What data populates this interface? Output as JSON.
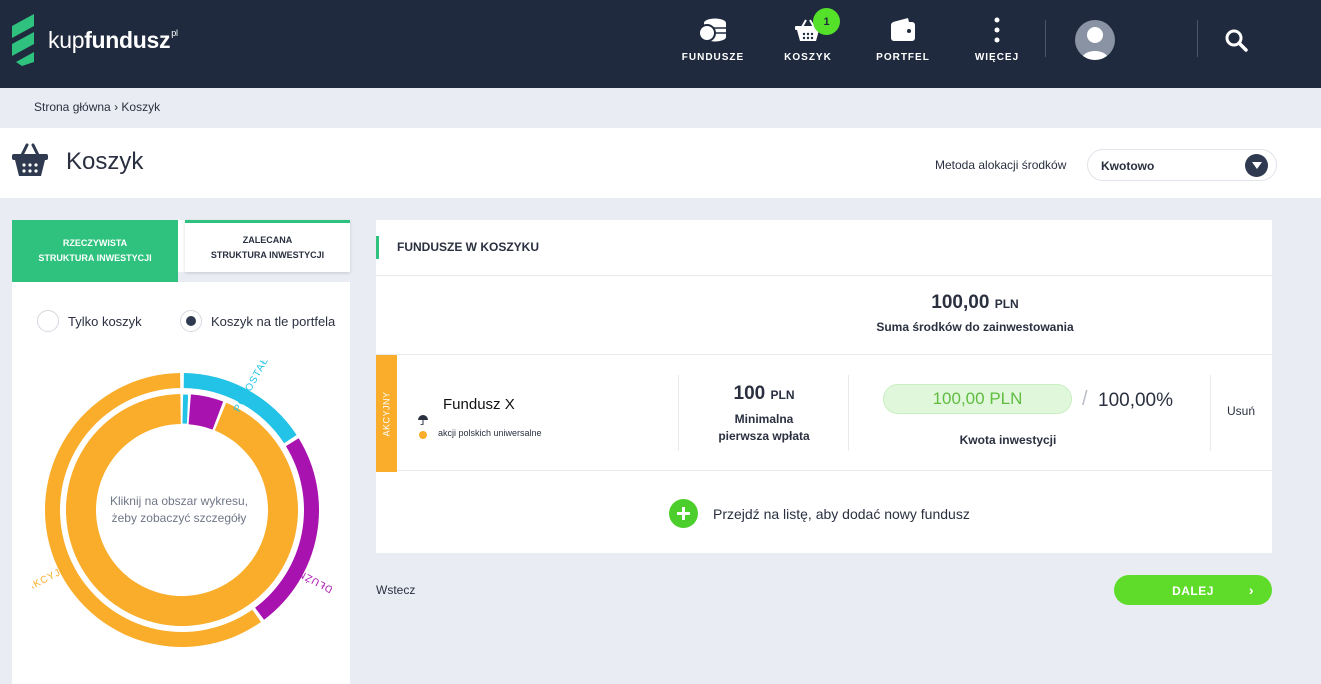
{
  "brand": {
    "name_light": "kup",
    "name_bold": "fundusz",
    "superscript": "pl"
  },
  "nav": {
    "items": [
      {
        "label": "FUNDUSZE"
      },
      {
        "label": "KOSZYK",
        "badge": "1"
      },
      {
        "label": "PORTFEL"
      },
      {
        "label": "WIĘCEJ"
      }
    ]
  },
  "breadcrumb": {
    "home": "Strona główna",
    "separator": "›",
    "current": "Koszyk"
  },
  "header": {
    "title": "Koszyk",
    "allocation_label": "Metoda alokacji środków",
    "allocation_value": "Kwotowo"
  },
  "left_panel": {
    "tabs": [
      {
        "line1": "RZECZYWISTA",
        "line2": "STRUKTURA INWESTYCJI",
        "active": true
      },
      {
        "line1": "ZALECANA",
        "line2": "STRUKTURA INWESTYCJI",
        "active": false
      }
    ],
    "radio_options": [
      {
        "label": "Tylko koszyk",
        "selected": false
      },
      {
        "label": "Koszyk na tle portfela",
        "selected": true
      }
    ],
    "chart_hint_line1": "Kliknij na obszar wykresu,",
    "chart_hint_line2": "żeby zobaczyć szczegóły"
  },
  "chart_data": {
    "type": "donut",
    "categories": [
      "POZOSTAŁE",
      "DŁUŻNE",
      "AKCYJNE"
    ],
    "colors": {
      "POZOSTAŁE": "#22c3e6",
      "DŁUŻNE": "#a812ae",
      "AKCYJNE": "#f9ad2a"
    },
    "series": [
      {
        "values": [
          16,
          24,
          60
        ]
      },
      {
        "values": [
          1,
          5,
          94
        ]
      }
    ]
  },
  "cart": {
    "title": "FUNDUSZE W KOSZYKU",
    "sum_value": "100,00",
    "sum_currency": "PLN",
    "sum_label": "Suma środków do zainwestowania",
    "fund": {
      "tag": "AKCYJNY",
      "name": "Fundusz X",
      "category": "akcji polskich uniwersalne",
      "min_value": "100",
      "min_currency": "PLN",
      "min_label_line1": "Minimalna",
      "min_label_line2": "pierwsza wpłata",
      "amount": "100,00 PLN",
      "slash": "/",
      "percent": "100,00%",
      "amount_label": "Kwota inwestycji",
      "remove": "Usuń"
    },
    "add_fund_text": "Przejdź na listę, aby dodać nowy fundusz"
  },
  "footer": {
    "back": "Wstecz",
    "next": "DALEJ",
    "next_chevron": "›"
  },
  "colors": {
    "topbar": "#1f2a3e",
    "accent_green": "#2fc27e",
    "button_green": "#5fdc2a",
    "equity_orange": "#f9ad2a",
    "debt_purple": "#a812ae",
    "other_cyan": "#22c3e6"
  }
}
